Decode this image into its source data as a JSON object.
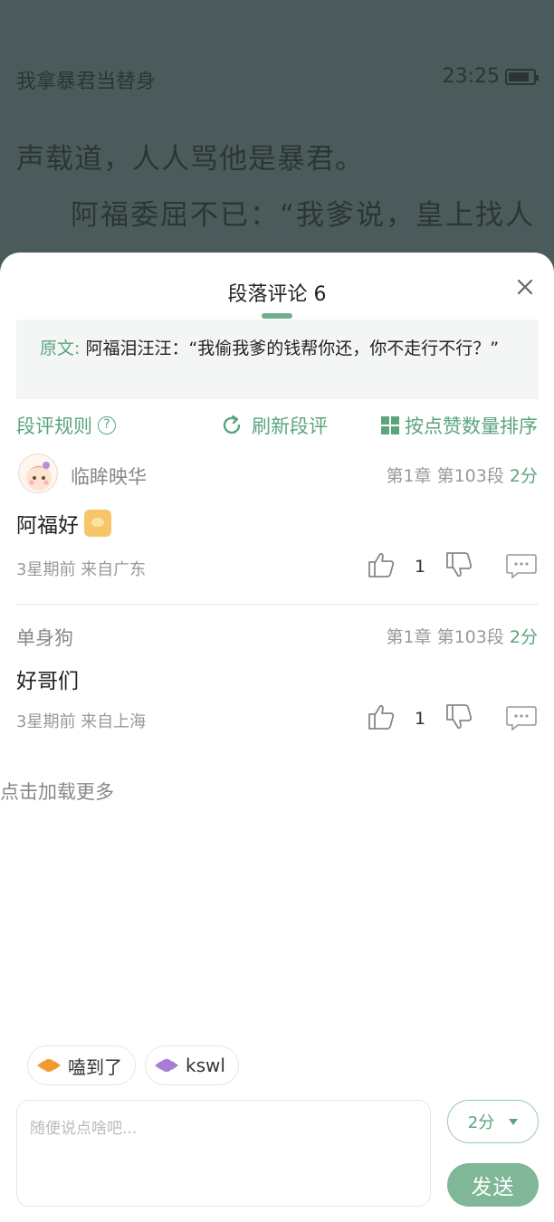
{
  "reader": {
    "book_title": "我拿暴君当替身",
    "time": "23:25",
    "line1": "声载道，人人骂他是暴君。",
    "line2": "阿福委屈不已：“我爹说，皇上找人"
  },
  "sheet": {
    "title": "段落评论 6",
    "quote_label": "原文:",
    "quote_text": "阿福泪汪汪：“我偷我爹的钱帮你还，你不走行不行？”",
    "rules_label": "段评规则",
    "help_symbol": "?",
    "refresh_label": "刷新段评",
    "sort_label": "按点赞数量排序",
    "accent_color": "#5ba47e"
  },
  "comments": [
    {
      "username": "临眸映华",
      "chapter": "第1章",
      "paragraph": "第103段",
      "score": "2分",
      "text": "阿福好",
      "has_emoji": true,
      "meta": "3星期前  来自广东",
      "likes": "1"
    },
    {
      "username": "单身狗",
      "chapter": "第1章",
      "paragraph": "第103段",
      "score": "2分",
      "text": "好哥们",
      "has_emoji": false,
      "meta": "3星期前  来自上海",
      "likes": "1"
    }
  ],
  "load_more": "点击加载更多",
  "quick_chips": [
    {
      "label": "嗑到了",
      "icon": "orange-candy-icon",
      "color": "#f29a2e"
    },
    {
      "label": "kswl",
      "icon": "purple-candy-icon",
      "color": "#a77bd6"
    }
  ],
  "composer": {
    "placeholder": "随便说点啥吧...",
    "score_value": "2分",
    "send_label": "发送"
  }
}
